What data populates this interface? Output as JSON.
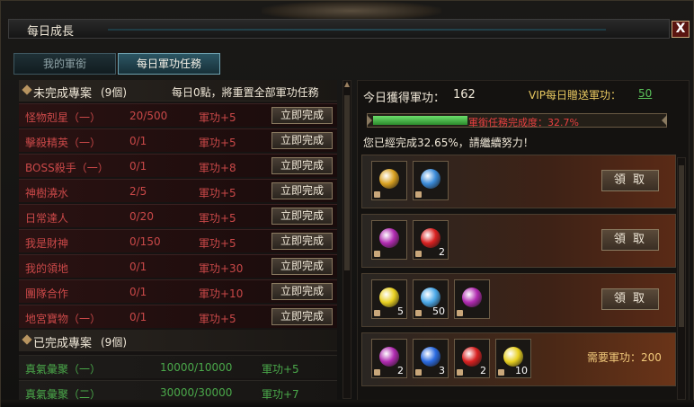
{
  "window": {
    "title": "每日成長",
    "close_label": "X"
  },
  "tabs": [
    {
      "label": "我的軍銜",
      "active": false
    },
    {
      "label": "每日軍功任務",
      "active": true
    }
  ],
  "incomplete": {
    "title": "未完成專案",
    "count": "(9個)",
    "note": "每日0點，將重置全部軍功任務",
    "tasks": [
      {
        "name": "怪物剋星（一）",
        "progress": "20/500",
        "reward": "軍功+5",
        "button": "立即完成"
      },
      {
        "name": "擊殺精英（一）",
        "progress": "0/1",
        "reward": "軍功+5",
        "button": "立即完成"
      },
      {
        "name": "BOSS殺手（一）",
        "progress": "0/1",
        "reward": "軍功+8",
        "button": "立即完成"
      },
      {
        "name": "神樹澆水",
        "progress": "2/5",
        "reward": "軍功+5",
        "button": "立即完成"
      },
      {
        "name": "日常達人",
        "progress": "0/20",
        "reward": "軍功+5",
        "button": "立即完成"
      },
      {
        "name": "我是財神",
        "progress": "0/150",
        "reward": "軍功+5",
        "button": "立即完成"
      },
      {
        "name": "我的領地",
        "progress": "0/1",
        "reward": "軍功+30",
        "button": "立即完成"
      },
      {
        "name": "團隊合作",
        "progress": "0/1",
        "reward": "軍功+10",
        "button": "立即完成"
      },
      {
        "name": "地宮寶物（一）",
        "progress": "0/1",
        "reward": "軍功+5",
        "button": "立即完成"
      }
    ]
  },
  "completed": {
    "title": "已完成專案",
    "count": "(9個)",
    "tasks": [
      {
        "name": "真氣彙聚（一）",
        "progress": "10000/10000",
        "reward": "軍功+5"
      },
      {
        "name": "真氣彙聚（二）",
        "progress": "30000/30000",
        "reward": "軍功+7"
      }
    ]
  },
  "summary": {
    "today_label": "今日獲得軍功：",
    "today_value": "162",
    "vip_label": "VIP每日贈送軍功：",
    "vip_value": "50",
    "progress_text": "軍銜任務完成度：32.7%",
    "progress_fraction": 0.327,
    "encourage": "您已經完成32.65%，請繼續努力！"
  },
  "reward_tiers": [
    {
      "items": [
        {
          "icon": "rainbow-amulet-icon",
          "qty": "",
          "color": "#d8a020"
        },
        {
          "icon": "blue-amulet-icon",
          "qty": "",
          "color": "#3a8ad8"
        }
      ],
      "button": "領 取"
    },
    {
      "items": [
        {
          "icon": "purple-orb-icon",
          "qty": "",
          "color": "#b02ab0"
        },
        {
          "icon": "red-rose-icon",
          "qty": "2",
          "color": "#d82020"
        }
      ],
      "button": "領 取"
    },
    {
      "items": [
        {
          "icon": "yellow-orb-icon",
          "qty": "5",
          "color": "#e8d020"
        },
        {
          "icon": "blue-crystal-icon",
          "qty": "50",
          "color": "#4aa8e8"
        },
        {
          "icon": "purple-orb-icon",
          "qty": "",
          "color": "#b02ab0"
        }
      ],
      "button": "領 取"
    },
    {
      "items": [
        {
          "icon": "purple-orb-icon",
          "qty": "2",
          "color": "#b02ab0"
        },
        {
          "icon": "blue-sphere-icon",
          "qty": "3",
          "color": "#2a6ae0"
        },
        {
          "icon": "red-rose-icon",
          "qty": "2",
          "color": "#d82020"
        },
        {
          "icon": "yellow-orb-icon",
          "qty": "10",
          "color": "#e8d020"
        }
      ],
      "need_label": "需要軍功：200"
    }
  ]
}
